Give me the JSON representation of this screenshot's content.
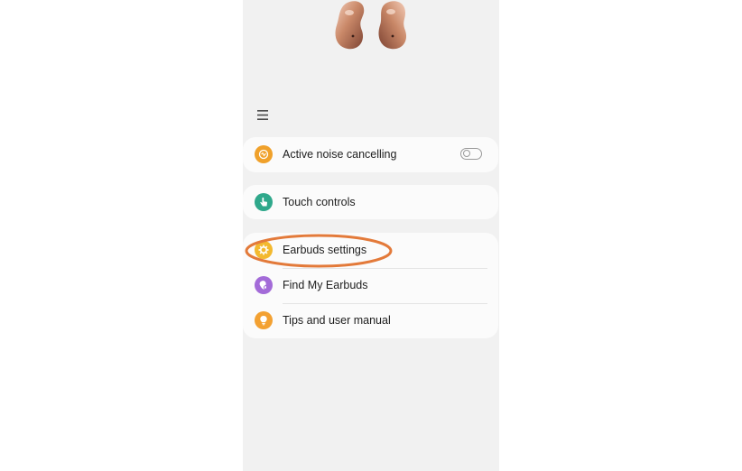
{
  "menu_icon": "hamburger-menu-icon",
  "sections": {
    "anc": {
      "label": "Active noise cancelling",
      "icon": "noise-cancelling-icon",
      "icon_color": "#f0a12b",
      "toggle_on": false
    },
    "touch": {
      "label": "Touch controls",
      "icon": "touch-hand-icon",
      "icon_color": "#2fa88b"
    },
    "list": [
      {
        "label": "Earbuds settings",
        "icon": "gear-icon",
        "icon_color": "#f3b92f"
      },
      {
        "label": "Find My Earbuds",
        "icon": "find-earbuds-icon",
        "icon_color": "#a36bd8"
      },
      {
        "label": "Tips and user manual",
        "icon": "lightbulb-icon",
        "icon_color": "#f3a132"
      }
    ]
  },
  "annotation": {
    "highlight_color": "#e37a3a"
  }
}
